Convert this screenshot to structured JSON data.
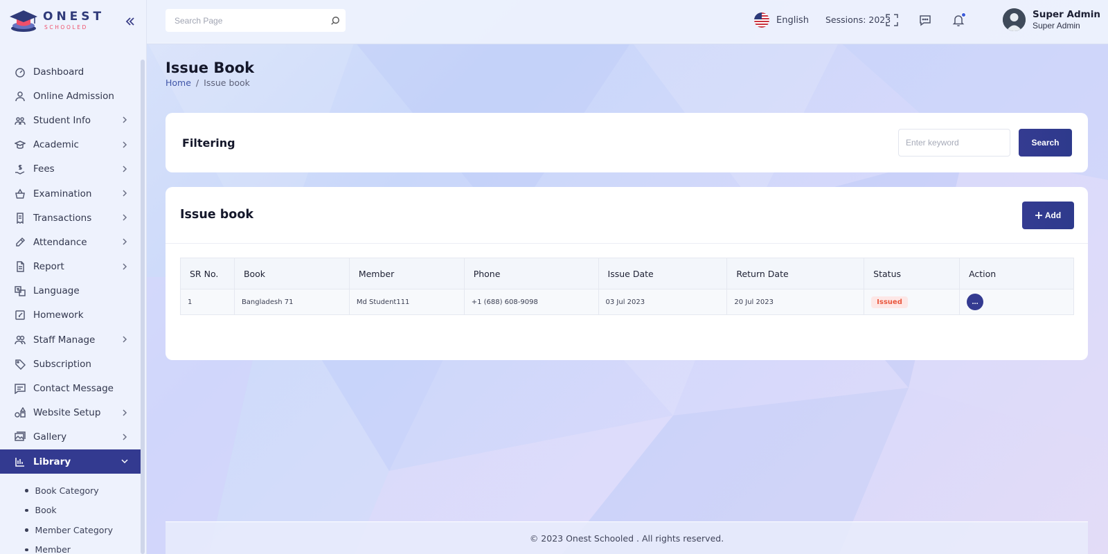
{
  "brand": {
    "name": "ONEST",
    "tagline": "SCHOOLED",
    "colors": {
      "primary": "#333a90",
      "accent": "#ef4f6a",
      "danger": "#e9583f"
    }
  },
  "sidebar": {
    "collapse_icon": "double-chevron-left-icon",
    "items": [
      {
        "label": "Dashboard",
        "icon": "speedometer-icon",
        "has_children": false
      },
      {
        "label": "Online Admission",
        "icon": "user-icon",
        "has_children": false
      },
      {
        "label": "Student Info",
        "icon": "students-icon",
        "has_children": true
      },
      {
        "label": "Academic",
        "icon": "graduation-cap-icon",
        "has_children": true
      },
      {
        "label": "Fees",
        "icon": "money-hand-icon",
        "has_children": true
      },
      {
        "label": "Examination",
        "icon": "basket-icon",
        "has_children": true
      },
      {
        "label": "Transactions",
        "icon": "receipt-icon",
        "has_children": true
      },
      {
        "label": "Attendance",
        "icon": "pen-icon",
        "has_children": true
      },
      {
        "label": "Report",
        "icon": "document-icon",
        "has_children": true
      },
      {
        "label": "Language",
        "icon": "translate-icon",
        "has_children": false
      },
      {
        "label": "Homework",
        "icon": "edit-icon",
        "has_children": false
      },
      {
        "label": "Staff Manage",
        "icon": "users-icon",
        "has_children": true
      },
      {
        "label": "Subscription",
        "icon": "tag-icon",
        "has_children": false
      },
      {
        "label": "Contact Message",
        "icon": "message-icon",
        "has_children": false
      },
      {
        "label": "Website Setup",
        "icon": "shapes-icon",
        "has_children": true
      },
      {
        "label": "Gallery",
        "icon": "gallery-icon",
        "has_children": true
      }
    ],
    "active_item": {
      "label": "Library",
      "icon": "library-icon",
      "expanded": true
    },
    "library_submenu": [
      "Book Category",
      "Book",
      "Member Category",
      "Member"
    ]
  },
  "topbar": {
    "search_placeholder": "Search Page",
    "language": "English",
    "session": "Sessions: 2023",
    "user_name": "Super Admin",
    "user_role": "Super Admin"
  },
  "page": {
    "title": "Issue Book",
    "breadcrumb": [
      "Home",
      "/",
      "Issue book"
    ]
  },
  "filter": {
    "title": "Filtering",
    "keyword_placeholder": "Enter keyword",
    "search_label": "Search"
  },
  "list": {
    "title": "Issue book",
    "add_label": "Add",
    "columns": [
      "SR No.",
      "Book",
      "Member",
      "Phone",
      "Issue Date",
      "Return Date",
      "Status",
      "Action"
    ],
    "rows": [
      {
        "sr": "1",
        "book": "Bangladesh 71",
        "member": "Md Student111",
        "phone": "+1 (688) 608-9098",
        "issue_date": "03 Jul 2023",
        "return_date": "20 Jul 2023",
        "status": "Issued",
        "action": "..."
      }
    ]
  },
  "footer": {
    "text": "© 2023 Onest Schooled . All rights reserved."
  }
}
